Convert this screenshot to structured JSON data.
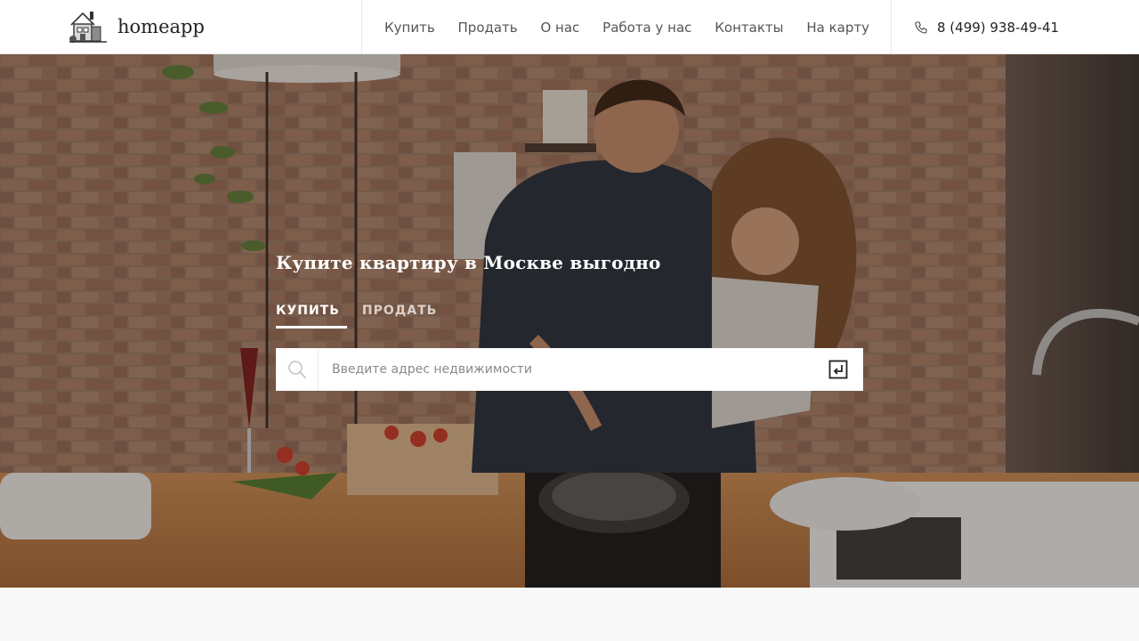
{
  "brand": {
    "name": "homeapp",
    "logo_icon": "house-logo-icon"
  },
  "nav": {
    "items": [
      {
        "label": "Купить"
      },
      {
        "label": "Продать"
      },
      {
        "label": "О нас"
      },
      {
        "label": "Работа у нас"
      },
      {
        "label": "Контакты"
      },
      {
        "label": "На карту"
      }
    ]
  },
  "contact": {
    "phone": "8 (499) 938-49-41",
    "icon": "phone-icon"
  },
  "hero": {
    "headline": "Купите квартиру в Москве выгодно",
    "tabs": [
      {
        "label": "КУПИТЬ",
        "active": true
      },
      {
        "label": "ПРОДАТЬ",
        "active": false
      }
    ],
    "search": {
      "value": "",
      "placeholder": "Введите адрес недвижимости",
      "icon": "search-icon",
      "submit_icon": "enter-icon"
    },
    "background": "kitchen-couple-photo"
  },
  "colors": {
    "header_bg": "#ffffff",
    "hero_text": "#ffffff",
    "page_bg": "#f8f8f8"
  }
}
